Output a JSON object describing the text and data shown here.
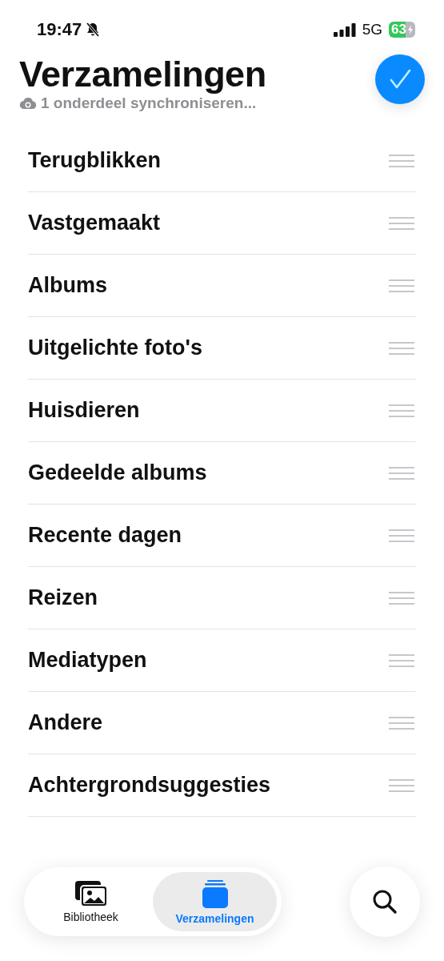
{
  "status_bar": {
    "time": "19:47",
    "network": "5G",
    "battery": "63"
  },
  "header": {
    "title": "Verzamelingen",
    "subtitle": "1 onderdeel synchroniseren..."
  },
  "items": [
    {
      "label": "Terugblikken"
    },
    {
      "label": "Vastgemaakt"
    },
    {
      "label": "Albums"
    },
    {
      "label": "Uitgelichte foto's"
    },
    {
      "label": "Huisdieren"
    },
    {
      "label": "Gedeelde albums"
    },
    {
      "label": "Recente dagen"
    },
    {
      "label": "Reizen"
    },
    {
      "label": "Mediatypen"
    },
    {
      "label": "Andere"
    },
    {
      "label": "Achtergrondsuggesties"
    }
  ],
  "tab_bar": {
    "tabs": [
      {
        "label": "Bibliotheek",
        "kind": "library",
        "selected": false
      },
      {
        "label": "Verzamelingen",
        "kind": "collections",
        "selected": true
      }
    ]
  }
}
